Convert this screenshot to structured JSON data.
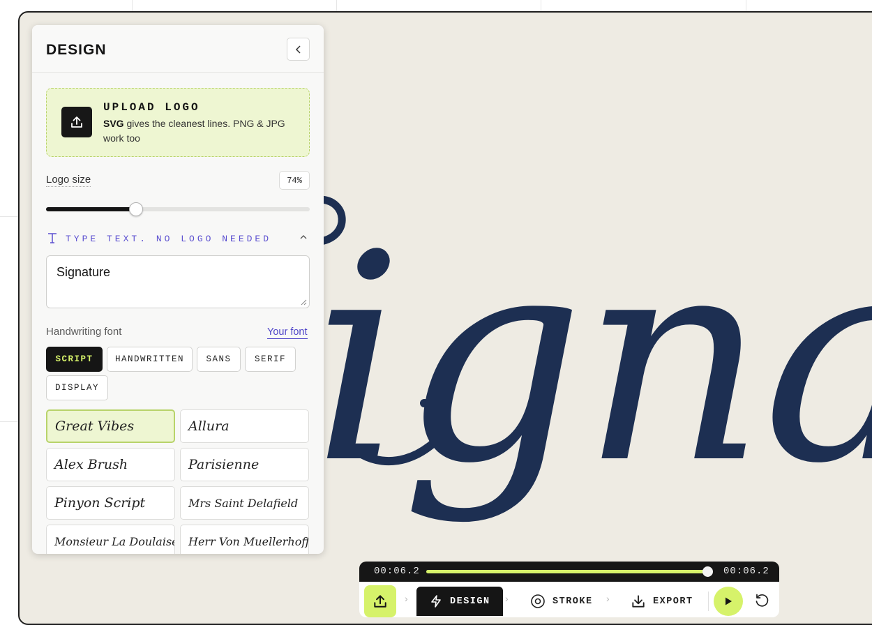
{
  "panel": {
    "title": "DESIGN",
    "upload": {
      "title": "UPLOAD LOGO",
      "desc_bold": "SVG",
      "desc_rest": " gives the cleanest lines. PNG & JPG work too"
    },
    "logo_size": {
      "label": "Logo size",
      "value": "74%",
      "fraction": 0.34
    },
    "type_text": {
      "label": "TYPE TEXT. NO LOGO NEEDED"
    },
    "text_input": {
      "value": "Signature"
    },
    "handwriting": {
      "label": "Handwriting font",
      "your_font": "Your font",
      "categories": [
        "SCRIPT",
        "HANDWRITTEN",
        "SANS",
        "SERIF",
        "DISPLAY"
      ],
      "active_category": "SCRIPT",
      "fonts": [
        "Great Vibes",
        "Allura",
        "Alex Brush",
        "Parisienne",
        "Pinyon Script",
        "Mrs Saint Delafield",
        "Monsieur La Doulaise",
        "Herr Von Muellerhoff"
      ],
      "selected_font": "Great Vibes"
    }
  },
  "canvas": {
    "preview_text": "ignature",
    "ink_color": "#1d2f52",
    "background": "#eeebe3"
  },
  "player": {
    "time_left": "00:06.2",
    "time_right": "00:06.2",
    "progress": 1.0,
    "steps": {
      "design": "DESIGN",
      "stroke": "STROKE",
      "export": "EXPORT"
    },
    "active_step": "DESIGN"
  },
  "colors": {
    "accent_lime": "#d6f26a",
    "accent_purple": "#4f45c9",
    "dark": "#151515"
  }
}
